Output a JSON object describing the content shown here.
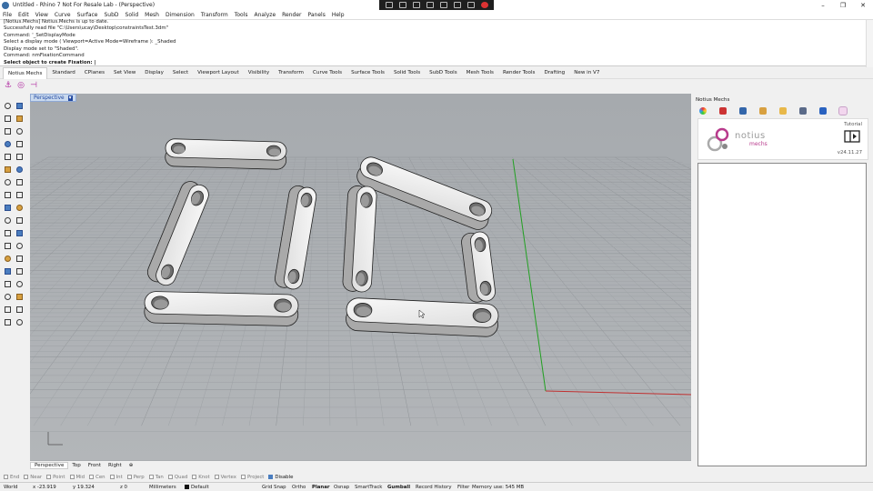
{
  "window": {
    "title": "Untitled - Rhino 7 Not For Resale Lab - (Perspective)",
    "controls": [
      "–",
      "❐",
      "✕"
    ]
  },
  "menu": [
    "File",
    "Edit",
    "View",
    "Curve",
    "Surface",
    "SubD",
    "Solid",
    "Mesh",
    "Dimension",
    "Transform",
    "Tools",
    "Analyze",
    "Render",
    "Panels",
    "Help"
  ],
  "command_history": [
    "[Notius.Mechs] Notius.Mechs is up to date.",
    "Successfully read file \"C:\\Users\\ucay\\Desktop\\constraintsTest.3dm\"",
    "Command: '_SetDisplayMode",
    "Select a display mode ( Viewport=Active  Mode=Wireframe ): _Shaded",
    "Display mode set to \"Shaded\".",
    "Command: nmFixationCommand"
  ],
  "command_prompt": "Select object to create Fixation:",
  "toolbar_tabs": [
    "Notius Mechs",
    "Standard",
    "CPlanes",
    "Set View",
    "Display",
    "Select",
    "Viewport Layout",
    "Visibility",
    "Transform",
    "Curve Tools",
    "Surface Tools",
    "Solid Tools",
    "SubD Tools",
    "Mesh Tools",
    "Render Tools",
    "Drafting",
    "New in V7"
  ],
  "mech_tools": [
    "anchor-icon",
    "target-icon",
    "align-icon"
  ],
  "viewport": {
    "label": "Perspective",
    "menu_arrow": "▾"
  },
  "viewport_tabs": [
    "Perspective",
    "Top",
    "Front",
    "Right",
    "⊕"
  ],
  "osnaps": [
    {
      "label": "End",
      "on": false
    },
    {
      "label": "Near",
      "on": false
    },
    {
      "label": "Point",
      "on": false
    },
    {
      "label": "Mid",
      "on": false
    },
    {
      "label": "Cen",
      "on": false
    },
    {
      "label": "Int",
      "on": false
    },
    {
      "label": "Perp",
      "on": false
    },
    {
      "label": "Tan",
      "on": false
    },
    {
      "label": "Quad",
      "on": false
    },
    {
      "label": "Knot",
      "on": false
    },
    {
      "label": "Vertex",
      "on": false
    },
    {
      "label": "Project",
      "on": false
    },
    {
      "label": "Disable",
      "on": true
    }
  ],
  "status": {
    "cplane": "World",
    "x": "x -23.919",
    "y": "y 19.324",
    "z": "z 0",
    "units": "Millimeters",
    "layer": "Default",
    "grid_snap": "Grid Snap",
    "ortho": "Ortho",
    "planar": "Planar",
    "osnap": "Osnap",
    "smarttrack": "SmartTrack",
    "gumball": "Gumball",
    "record_history": "Record History",
    "filter": "Filter",
    "memory": "Memory use: 545 MB"
  },
  "panel": {
    "title": "Notius Mechs",
    "brand": "notius",
    "brand_sub": "mechs",
    "tutorial": "Tutorial",
    "version": "v24.11.27"
  },
  "colors": {
    "accent": "#b02aa0",
    "viewport_bg": "#a8adb1",
    "y_axis": "#22a022",
    "x_axis": "#c03030"
  }
}
